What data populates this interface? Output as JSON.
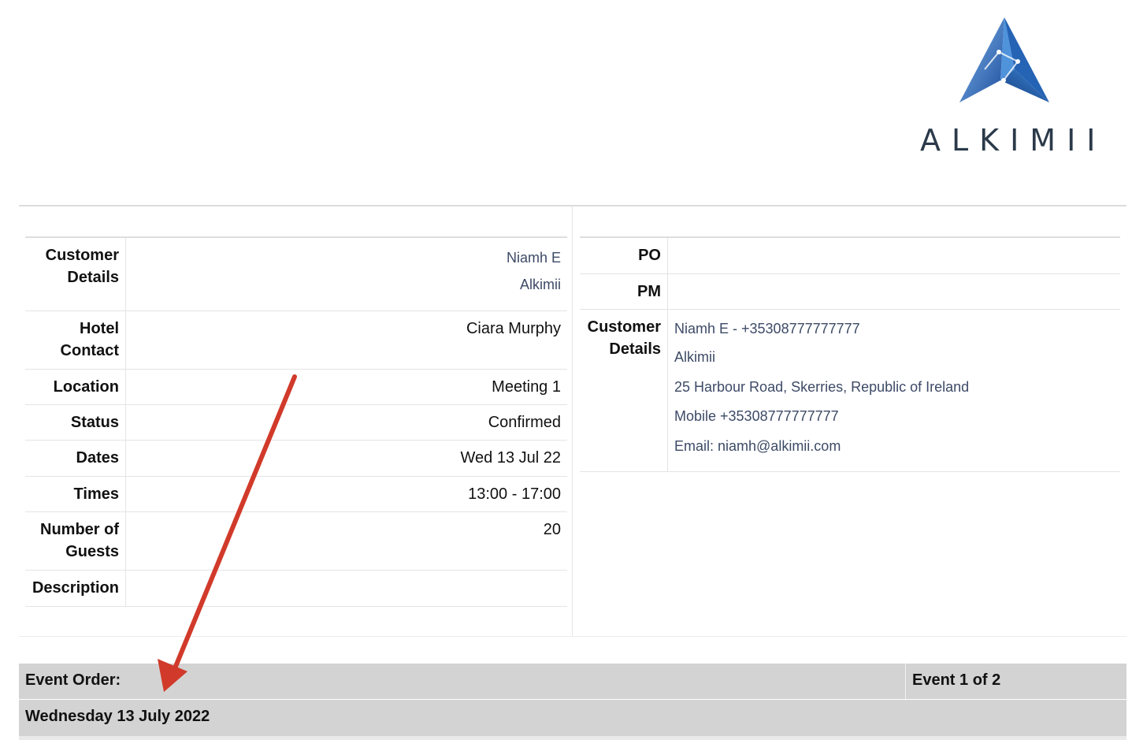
{
  "logo": {
    "text": "ALKIMII"
  },
  "left": {
    "customer_details": {
      "label": "Customer Details",
      "name": "Niamh E",
      "company": "Alkimii"
    },
    "hotel_contact": {
      "label": "Hotel Contact",
      "value": "Ciara Murphy"
    },
    "location": {
      "label": "Location",
      "value": "Meeting 1"
    },
    "status": {
      "label": "Status",
      "value": "Confirmed"
    },
    "dates": {
      "label": "Dates",
      "value": "Wed 13 Jul 22"
    },
    "times": {
      "label": "Times",
      "value": "13:00 - 17:00"
    },
    "guests": {
      "label": "Number of Guests",
      "value": "20"
    },
    "description": {
      "label": "Description",
      "value": ""
    }
  },
  "right": {
    "po": {
      "label": "PO",
      "value": ""
    },
    "pm": {
      "label": "PM",
      "value": ""
    },
    "customer_details": {
      "label": "Customer Details",
      "lines": [
        "Niamh E - +35308777777777",
        "Alkimii",
        "25 Harbour Road, Skerries, Republic of Ireland",
        "Mobile +35308777777777",
        "Email: niamh@alkimii.com"
      ]
    }
  },
  "event": {
    "order_label": "Event Order:",
    "counter": "Event 1 of 2",
    "date_heading": "Wednesday 13 July 2022"
  },
  "colors": {
    "annotation_arrow": "#d13a2a",
    "bar_bg": "#d3d3d3",
    "logo_blue": "#2f6fc4"
  }
}
